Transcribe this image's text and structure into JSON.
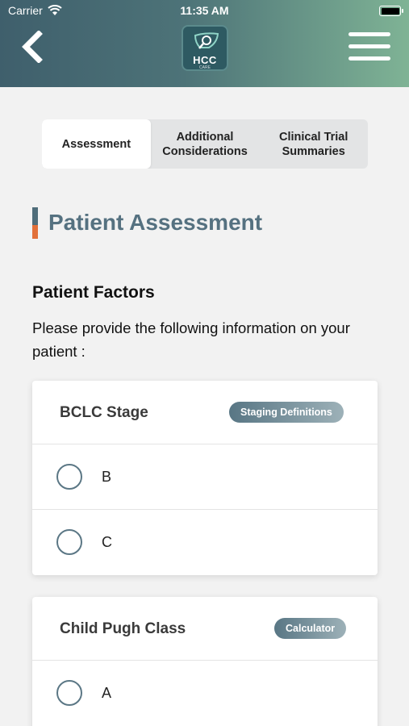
{
  "status_bar": {
    "carrier": "Carrier",
    "time": "11:35 AM"
  },
  "header": {
    "logo_text": "HCC",
    "logo_subtext": "CARE",
    "back_icon": "chevron-left-icon",
    "menu_icon": "hamburger-menu-icon"
  },
  "tabs": [
    {
      "label": "Assessment",
      "active": true
    },
    {
      "label": "Additional Considerations",
      "active": false
    },
    {
      "label": "Clinical Trial Summaries",
      "active": false
    }
  ],
  "section": {
    "title": "Patient Assessment",
    "factors_title": "Patient Factors",
    "instructions": "Please provide the following information on your patient :"
  },
  "cards": [
    {
      "title": "BCLC Stage",
      "button_label": "Staging Definitions",
      "options": [
        "B",
        "C"
      ]
    },
    {
      "title": "Child Pugh Class",
      "button_label": "Calculator",
      "options": [
        "A"
      ]
    }
  ],
  "colors": {
    "header_start": "#3f5f6c",
    "header_end": "#7fb395",
    "title": "#557180",
    "accent_orange": "#e2703a",
    "radio": "#5b7785"
  }
}
